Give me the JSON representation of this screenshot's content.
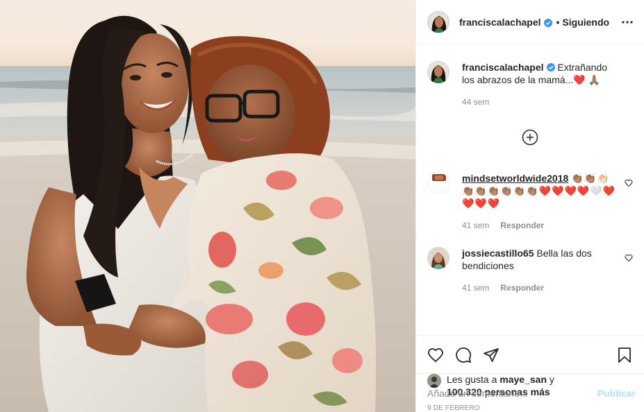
{
  "post": {
    "author": "franciscalachapel",
    "verified": true,
    "follow_status": "Siguiendo",
    "separator": "•"
  },
  "caption": {
    "username": "franciscalachapel",
    "text": "Extrañando los abrazos de la mamá...",
    "emojis": "❤️ 🙏🏽",
    "age": "44 sem"
  },
  "comments": [
    {
      "username": "mindsetworldwide2018",
      "text": "👏🏽👏🏽👏🏻👏🏽👏🏽👏🏽👏🏽👏🏽👏🏽❤️❤️❤️❤️🤍❤️❤️❤️❤️",
      "age": "41 sem",
      "reply_label": "Responder"
    },
    {
      "username": "jossiecastillo65",
      "text": "Bella las dos bendiciones",
      "age": "41 sem",
      "reply_label": "Responder"
    }
  ],
  "likes": {
    "prefix": "Les gusta a",
    "first_user": "maye_san",
    "joiner": "y",
    "others": "100.320 personas más"
  },
  "date": "9 de febrero",
  "add_comment": {
    "placeholder": "Añade un comentario...",
    "publish_label": "Publicar"
  },
  "icons": {
    "more": "more-options-icon",
    "load_more": "plus-circle-icon",
    "like": "heart-icon",
    "comment": "comment-icon",
    "share": "send-icon",
    "save": "bookmark-icon",
    "comment_like": "small-heart-icon",
    "verified": "verified-badge-icon"
  },
  "colors": {
    "verified": "#3897f0",
    "publish_disabled": "#b2dffc",
    "secondary_text": "#8e8e8e",
    "primary_text": "#262626"
  }
}
